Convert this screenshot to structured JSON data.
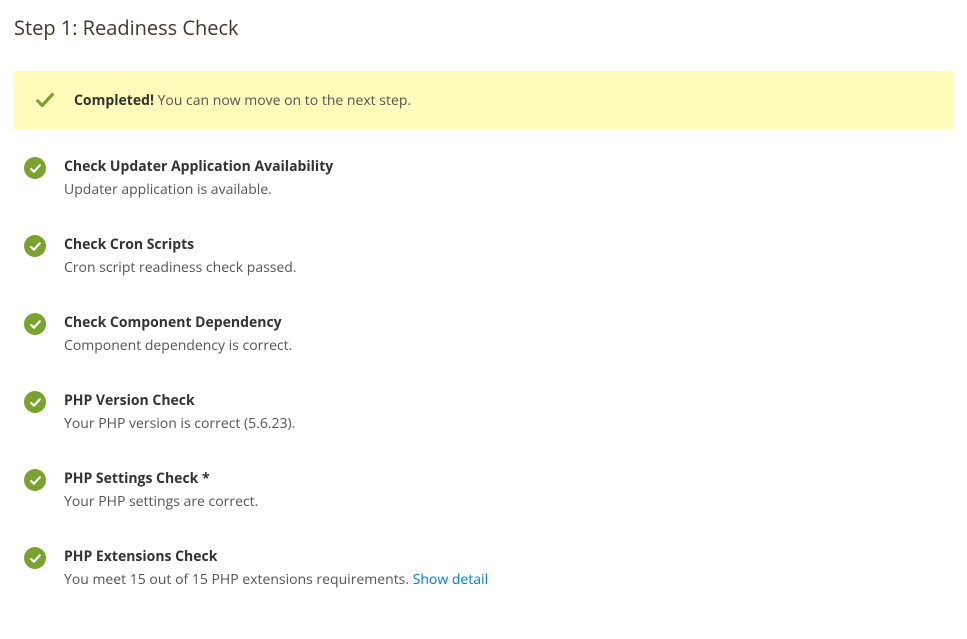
{
  "page_title": "Step 1: Readiness Check",
  "banner": {
    "bold": "Completed!",
    "text": " You can now move on to the next step."
  },
  "checks": [
    {
      "title": "Check Updater Application Availability",
      "desc": "Updater application is available."
    },
    {
      "title": "Check Cron Scripts",
      "desc": "Cron script readiness check passed."
    },
    {
      "title": "Check Component Dependency",
      "desc": "Component dependency is correct."
    },
    {
      "title": "PHP Version Check",
      "desc": "Your PHP version is correct (5.6.23)."
    },
    {
      "title": "PHP Settings Check *",
      "desc": "Your PHP settings are correct."
    },
    {
      "title": "PHP Extensions Check",
      "desc": "You meet 15 out of 15 PHP extensions requirements. ",
      "link": "Show detail"
    }
  ]
}
